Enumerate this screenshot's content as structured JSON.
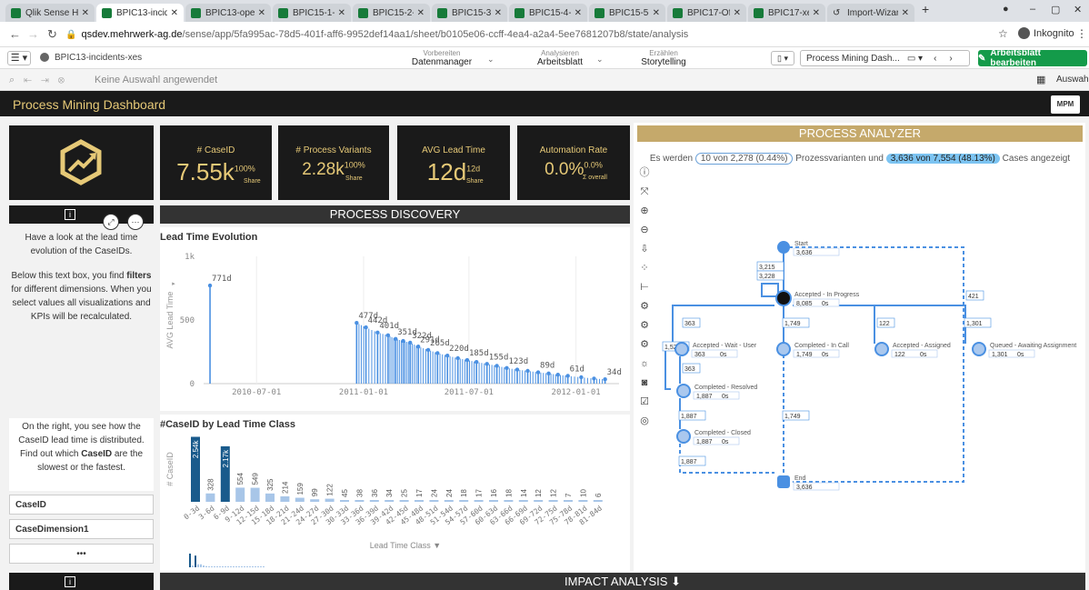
{
  "browser": {
    "tabs": [
      {
        "label": "Qlik Sense Hub"
      },
      {
        "label": "BPIC13-incident"
      },
      {
        "label": "BPIC13-open-p"
      },
      {
        "label": "BPIC15-1-xes -"
      },
      {
        "label": "BPIC15-2-xes -"
      },
      {
        "label": "BPIC15-3-xes -"
      },
      {
        "label": "BPIC15-4-xes -"
      },
      {
        "label": "BPIC15-5-xes -"
      },
      {
        "label": "BPIC17-Offer-lo"
      },
      {
        "label": "BPIC17-xes - Ar"
      },
      {
        "label": "Import-Wizard"
      }
    ],
    "new_tab": "+",
    "url_host": "qsdev.mehrwerk-ag.de",
    "url_path": "/sense/app/5fa995ac-78d5-401f-aff6-9952def14aa1/sheet/b0105e06-ccff-4ea4-a2a4-5ee7681207b8/state/analysis",
    "incognito": "Inkognito"
  },
  "qlik": {
    "app_name": "BPIC13-incidents-xes",
    "steps": [
      {
        "small": "Vorbereiten",
        "label": "Datenmanager"
      },
      {
        "small": "Analysieren",
        "label": "Arbeitsblatt"
      },
      {
        "small": "Erzählen",
        "label": "Storytelling"
      }
    ],
    "sheet_name": "Process Mining Dash...",
    "edit_button": "Arbeitsblatt bearbeiten",
    "no_selection": "Keine Auswahl angewendet",
    "auswahl": "Auswahl"
  },
  "dashboard": {
    "title": "Process Mining Dashboard",
    "mpm": "MPM"
  },
  "kpis": [
    {
      "label": "# CaseID",
      "value": "7.55k",
      "sup": "100%",
      "sub": "Share"
    },
    {
      "label": "# Process Variants",
      "value": "2.28k",
      "sup": "100%",
      "sub": "Share"
    },
    {
      "label": "AVG Lead Time",
      "value": "12d",
      "sup": "12d",
      "sub": "Share"
    },
    {
      "label": "Automation Rate",
      "value": "0.0%",
      "sup": "0.0%",
      "sub": "Σ overall"
    }
  ],
  "info": {
    "text1": "Have a look at the lead time evolution of the CaseIDs.",
    "text2a": "Below this text box, you find ",
    "text2b": "filters",
    "text2c": " for different dimensions. When you select values all visualizations and KPIs will be recalculated.",
    "text3a": "On the right, you see how the CaseID lead time is distributed. Find out which ",
    "text3b": "CaseID",
    "text3c": " are the slowest or the fastest."
  },
  "filters": [
    "CaseID",
    "CaseDimension1",
    "•••"
  ],
  "process_discovery": "PROCESS DISCOVERY",
  "impact_analysis": "IMPACT ANALYSIS ⬇",
  "chart_data": [
    {
      "type": "bar",
      "title": "Lead Time Evolution",
      "ylabel": "AVG Lead Time",
      "ylim": [
        0,
        1000
      ],
      "yticks": [
        "0",
        "500",
        "1k"
      ],
      "xticks": [
        "2010-07-01",
        "2011-01-01",
        "2011-07-01",
        "2012-01-01"
      ],
      "xlim": [
        "2010-04-01",
        "2012-03-15"
      ],
      "points": [
        {
          "x": "2010-04-12",
          "y": 771,
          "label": "771d"
        },
        {
          "x": "2010-12-20",
          "y": 477,
          "label": "477d"
        },
        {
          "x": "2011-01-05",
          "y": 442,
          "label": "442d"
        },
        {
          "x": "2011-01-25",
          "y": 401,
          "label": "401d"
        },
        {
          "x": "2011-02-12",
          "y": 380,
          "label": ""
        },
        {
          "x": "2011-02-25",
          "y": 351,
          "label": "351d"
        },
        {
          "x": "2011-03-10",
          "y": 335,
          "label": ""
        },
        {
          "x": "2011-03-22",
          "y": 322,
          "label": "322d"
        },
        {
          "x": "2011-04-05",
          "y": 291,
          "label": "291d"
        },
        {
          "x": "2011-04-22",
          "y": 265,
          "label": "265d"
        },
        {
          "x": "2011-05-08",
          "y": 240,
          "label": ""
        },
        {
          "x": "2011-05-25",
          "y": 220,
          "label": "220d"
        },
        {
          "x": "2011-06-12",
          "y": 200,
          "label": ""
        },
        {
          "x": "2011-06-28",
          "y": 185,
          "label": "185d"
        },
        {
          "x": "2011-07-14",
          "y": 170,
          "label": ""
        },
        {
          "x": "2011-08-01",
          "y": 155,
          "label": "155d"
        },
        {
          "x": "2011-08-18",
          "y": 140,
          "label": ""
        },
        {
          "x": "2011-09-04",
          "y": 123,
          "label": "123d"
        },
        {
          "x": "2011-09-22",
          "y": 110,
          "label": ""
        },
        {
          "x": "2011-10-10",
          "y": 100,
          "label": ""
        },
        {
          "x": "2011-10-28",
          "y": 89,
          "label": "89d"
        },
        {
          "x": "2011-11-15",
          "y": 80,
          "label": ""
        },
        {
          "x": "2011-12-01",
          "y": 70,
          "label": ""
        },
        {
          "x": "2011-12-18",
          "y": 61,
          "label": "61d"
        },
        {
          "x": "2012-01-10",
          "y": 50,
          "label": ""
        },
        {
          "x": "2012-02-01",
          "y": 40,
          "label": ""
        },
        {
          "x": "2012-02-20",
          "y": 34,
          "label": "34d"
        }
      ],
      "color": "#4a90e2"
    },
    {
      "type": "bar",
      "title": "#CaseID by Lead Time Class",
      "xlabel": "Lead Time Class",
      "ylabel": "# CaseID",
      "categories": [
        "0-3d",
        "3-6d",
        "6-9d",
        "9-12d",
        "12-15d",
        "15-18d",
        "18-21d",
        "21-24d",
        "24-27d",
        "27-30d",
        "30-33d",
        "33-36d",
        "36-39d",
        "39-42d",
        "42-45d",
        "45-48d",
        "48-51d",
        "51-54d",
        "54-57d",
        "57-60d",
        "60-63d",
        "63-66d",
        "66-69d",
        "69-72d",
        "72-75d",
        "75-78d",
        "78-81d",
        "81-84d"
      ],
      "values": [
        2540,
        328,
        2170,
        554,
        549,
        325,
        214,
        159,
        99,
        122,
        45,
        38,
        36,
        34,
        25,
        17,
        24,
        24,
        18,
        17,
        16,
        18,
        14,
        12,
        12,
        7,
        10,
        6
      ],
      "labels": [
        "2.54k",
        "328",
        "2.17k",
        "554",
        "549",
        "325",
        "214",
        "159",
        "99",
        "122",
        "45",
        "38",
        "36",
        "34",
        "25",
        "17",
        "24",
        "24",
        "18",
        "17",
        "16",
        "18",
        "14",
        "12",
        "12",
        "7",
        "10",
        "6"
      ],
      "highlight_color": "#1a5b8c",
      "color": "#a8c6e8"
    }
  ],
  "analyzer": {
    "title": "PROCESS ANALYZER",
    "prefix": "Es werden",
    "variants": "10 von 2,278 (0.44%)",
    "mid": "Prozessvarianten und",
    "cases": "3,636 von 7,554 (48.13%)",
    "suffix": "Cases angezeigt",
    "nodes": [
      {
        "name": "Start",
        "count": "3,636"
      },
      {
        "name": "Accepted - In Progress",
        "count": "8,085",
        "time": "0s"
      },
      {
        "name": "Accepted - Wait - User",
        "count": "363",
        "time": "0s"
      },
      {
        "name": "Completed - In Call",
        "count": "1,749",
        "time": "0s"
      },
      {
        "name": "Accepted - Assigned",
        "count": "122",
        "time": "0s"
      },
      {
        "name": "Queued - Awaiting Assignment",
        "count": "1,301",
        "time": "0s"
      },
      {
        "name": "Completed - Resolved",
        "count": "1,887",
        "time": "0s"
      },
      {
        "name": "Completed - Closed",
        "count": "1,887",
        "time": "0s"
      },
      {
        "name": "End",
        "count": "3,636"
      }
    ],
    "edges": [
      "3,215",
      "3,228",
      "421",
      "363",
      "1,749",
      "122",
      "1,301",
      "1,524",
      "363",
      "1,887",
      "1,749",
      "1,887"
    ]
  }
}
